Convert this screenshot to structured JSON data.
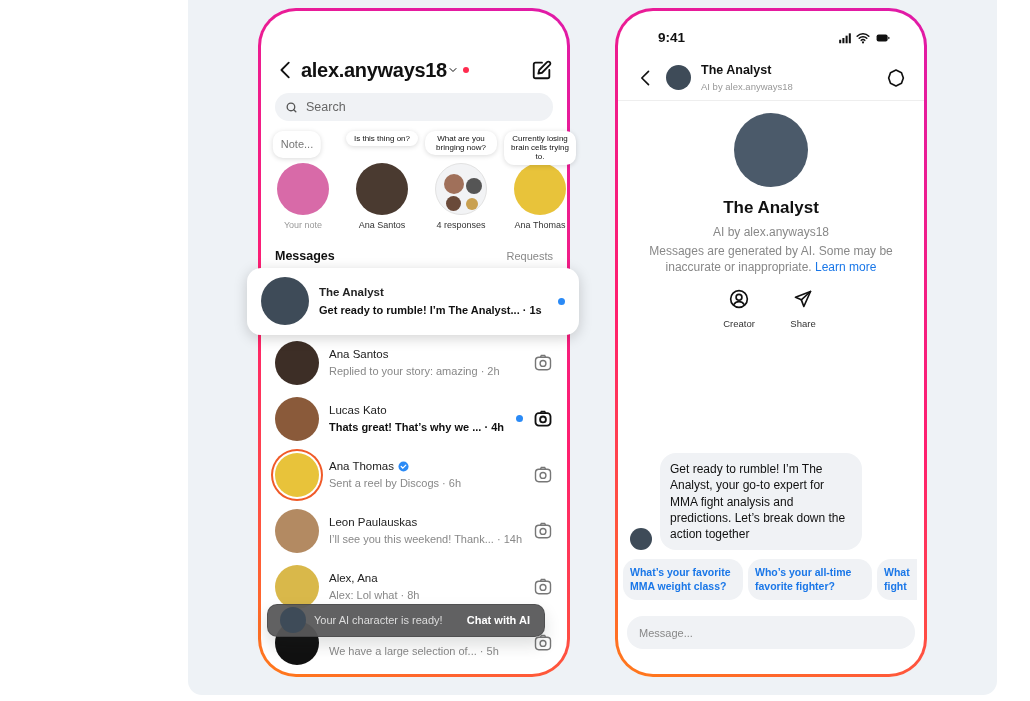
{
  "inbox_phone": {
    "header": {
      "username": "alex.anyways18",
      "has_alert": true
    },
    "search": {
      "placeholder": "Search"
    },
    "notes": [
      {
        "kind": "own",
        "bubble": "Note...",
        "label": "Your note"
      },
      {
        "kind": "person",
        "bubble": "Is this thing on?",
        "label": "Ana Santos"
      },
      {
        "kind": "group",
        "bubble": "What are you bringing now?",
        "label": "4 responses"
      },
      {
        "kind": "person",
        "bubble": "Currently losing brain cells trying to.",
        "label": "Ana Thomas"
      }
    ],
    "section_title": "Messages",
    "requests_label": "Requests",
    "threads": [
      {
        "name": "The Analyst",
        "preview": "Get ready to rumble! I’m The Analyst...",
        "time": "· 1s",
        "unread": true,
        "highlighted": true,
        "verified": false,
        "story_ring": false,
        "camera": false
      },
      {
        "name": "Ana Santos",
        "preview": "Replied to your story: amazing",
        "time": "· 2h",
        "unread": false,
        "highlighted": false,
        "verified": false,
        "story_ring": false,
        "camera": true
      },
      {
        "name": "Lucas Kato",
        "preview": "Thats great! That’s why we ...",
        "time": "· 4h",
        "unread": true,
        "highlighted": false,
        "verified": false,
        "story_ring": false,
        "camera": true
      },
      {
        "name": "Ana Thomas",
        "preview": "Sent a reel by Discogs",
        "time": "· 6h",
        "unread": false,
        "highlighted": false,
        "verified": true,
        "story_ring": true,
        "camera": true
      },
      {
        "name": "Leon Paulauskas",
        "preview": "I’ll see you this weekend! Thank...",
        "time": "· 14h",
        "unread": false,
        "highlighted": false,
        "verified": false,
        "story_ring": false,
        "camera": true
      },
      {
        "name": "Alex, Ana",
        "preview": "Alex: Lol what",
        "time": "· 8h",
        "unread": false,
        "highlighted": false,
        "verified": false,
        "story_ring": false,
        "camera": true
      },
      {
        "preview": "We have a large selection of...",
        "time": "· 5h",
        "unread": false,
        "highlighted": false,
        "verified": false,
        "story_ring": false,
        "camera": true
      }
    ],
    "toast": {
      "text": "Your AI character is ready!",
      "action": "Chat with AI"
    }
  },
  "chat_phone": {
    "status_bar": {
      "time": "9:41"
    },
    "header": {
      "name": "The Analyst",
      "subtitle": "AI by alex.anyways18"
    },
    "profile": {
      "name": "The Analyst",
      "subtitle": "AI by alex.anyways18",
      "disclaimer": "Messages are generated by AI. Some may be inaccurate or inappropriate.",
      "link": "Learn more"
    },
    "actions": [
      {
        "kind": "creator",
        "label": "Creator"
      },
      {
        "kind": "share",
        "label": "Share"
      }
    ],
    "message": "Get ready to rumble! I’m The Analyst, your go-to expert for MMA fight analysis and predictions. Let’s break down the action together",
    "suggestions": [
      "What’s your favorite MMA weight class?",
      "Who’s your all-time favorite fighter?",
      "What fight"
    ],
    "composer": {
      "placeholder": "Message..."
    }
  }
}
